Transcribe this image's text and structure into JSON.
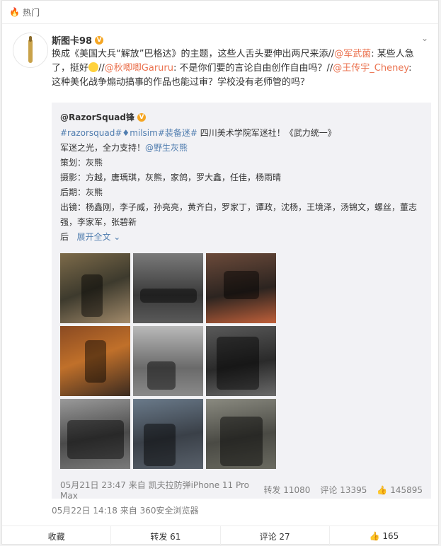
{
  "topbar": {
    "label": "热门",
    "icon": "flame-icon"
  },
  "post": {
    "author": "斯图卡98",
    "verified_badge": "V",
    "text_parts": [
      "换成《美国大兵“解放”巴格达》的主题，这些人舌头要伸出两尺来添//",
      "@军武菌",
      ": 某些人急了，挺好",
      "//",
      "@秋唧唧Garuru",
      ": 不是你们要的言论自由创作自由吗？//",
      "@王传宇_Cheney",
      ": 这种美化战争煽动搞事的作品也能过审？学校没有老师管的吗？"
    ],
    "time": "05月22日 14:18",
    "from": "来自 360安全浏览器"
  },
  "repost": {
    "author": "@RazorSquad锋",
    "tag1": "#razorsquad#",
    "tag2": "milsim",
    "tag3": "#装备迷#",
    "line1_rest": " 四川美术学院军迷社！《武力统一》",
    "line2": "军迷之光，全力支持！",
    "line2_mention": "@野生灰熊",
    "line3": "策划：灰熊",
    "line4": "摄影：方越，唐瑀琪，灰熊，家鸽，罗大鑫，任佳，杨雨晴",
    "line5": "后期：灰熊",
    "line6": "出镜：杨鑫刚，李子威，孙亮亮，黄齐白，罗家丁，谭政，沈杨，王境泽，汤锦文，螺丝，董志强，李家军，张碧新",
    "line7_prefix": "后",
    "expand": "展开全文",
    "time": "05月21日 23:47",
    "source": "来自 凯夫拉防弹iPhone 11 Pro Max",
    "repost_label": "转发 11080",
    "comment_label": "评论 13395",
    "like_count": "145895"
  },
  "actions": {
    "collect": "收藏",
    "repost": "转发 61",
    "comment": "评论 27",
    "like": "165"
  }
}
